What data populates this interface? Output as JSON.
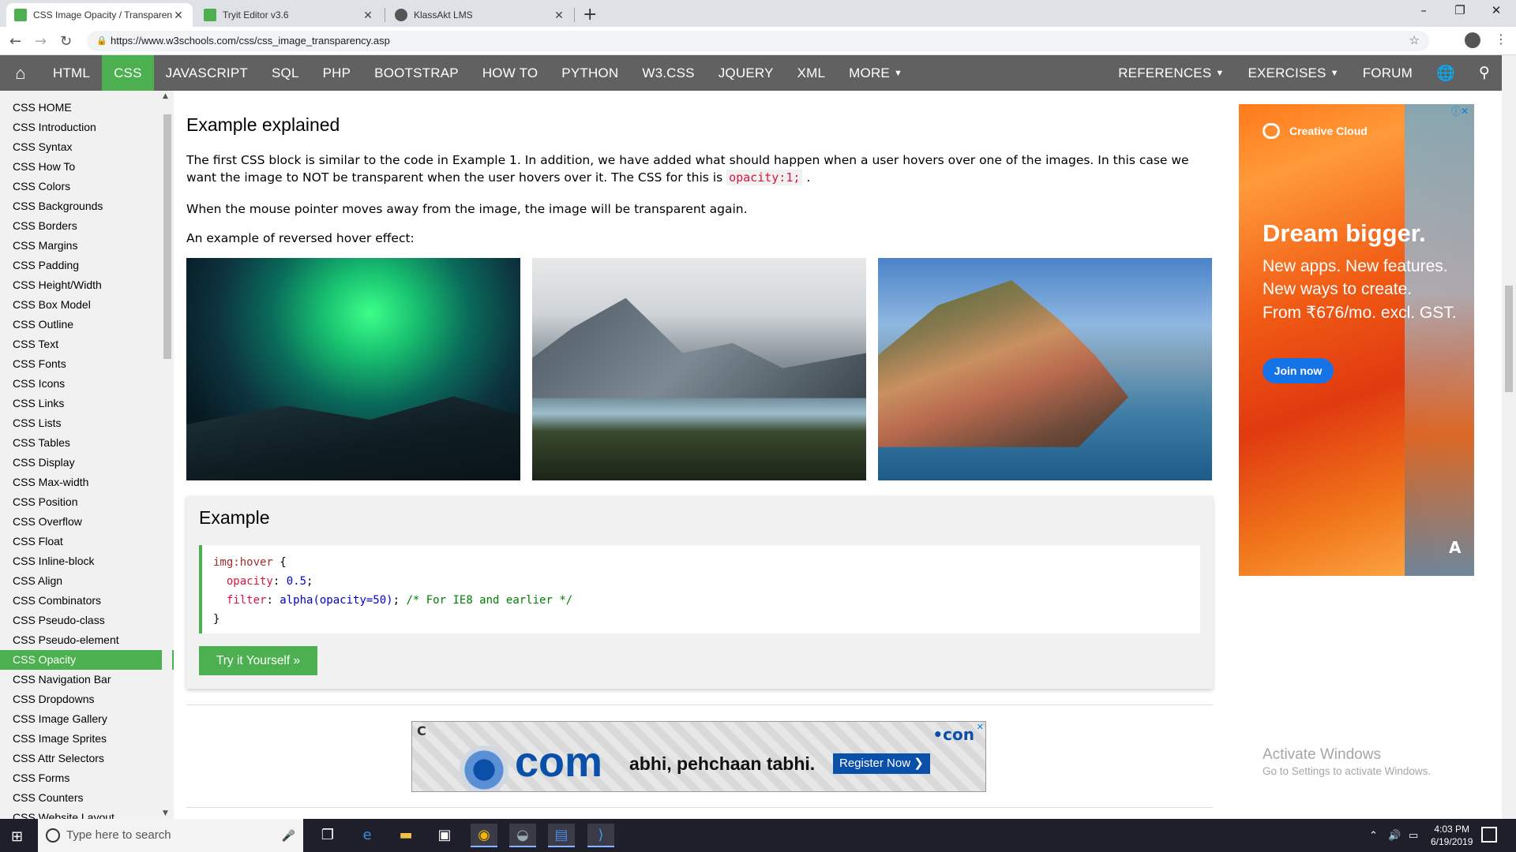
{
  "browser": {
    "tabs": [
      {
        "title": "CSS Image Opacity / Transparenc",
        "favicon_color": "#4CAF50"
      },
      {
        "title": "Tryit Editor v3.6",
        "favicon_color": "#4CAF50"
      },
      {
        "title": "KlassAkt LMS",
        "favicon_color": "#555555"
      }
    ],
    "url": "https://www.w3schools.com/css/css_image_transparency.asp",
    "new_tab": "+",
    "minimize": "–",
    "restore": "❐",
    "close": "✕"
  },
  "topnav": {
    "home_icon": "⌂",
    "items": [
      "HTML",
      "CSS",
      "JAVASCRIPT",
      "SQL",
      "PHP",
      "BOOTSTRAP",
      "HOW TO",
      "PYTHON",
      "W3.CSS",
      "JQUERY",
      "XML"
    ],
    "more": "MORE",
    "right": [
      "REFERENCES",
      "EXERCISES",
      "FORUM"
    ],
    "active": "CSS",
    "accent": "#4CAF50"
  },
  "sidebar": {
    "items": [
      "CSS HOME",
      "CSS Introduction",
      "CSS Syntax",
      "CSS How To",
      "CSS Colors",
      "CSS Backgrounds",
      "CSS Borders",
      "CSS Margins",
      "CSS Padding",
      "CSS Height/Width",
      "CSS Box Model",
      "CSS Outline",
      "CSS Text",
      "CSS Fonts",
      "CSS Icons",
      "CSS Links",
      "CSS Lists",
      "CSS Tables",
      "CSS Display",
      "CSS Max-width",
      "CSS Position",
      "CSS Overflow",
      "CSS Float",
      "CSS Inline-block",
      "CSS Align",
      "CSS Combinators",
      "CSS Pseudo-class",
      "CSS Pseudo-element",
      "CSS Opacity",
      "CSS Navigation Bar",
      "CSS Dropdowns",
      "CSS Image Gallery",
      "CSS Image Sprites",
      "CSS Attr Selectors",
      "CSS Forms",
      "CSS Counters",
      "CSS Website Layout"
    ],
    "active": "CSS Opacity"
  },
  "main": {
    "heading": "Example explained",
    "para1_a": "The first CSS block is similar to the code in Example 1. In addition, we have added what should happen when a user hovers over one of the images. In this case we want the image to NOT be transparent when the user hovers over it. The CSS for this is",
    "para1_code": "opacity:1;",
    "para1_end": ".",
    "para2": "When the mouse pointer moves away from the image, the image will be transparent again.",
    "para3": "An example of reversed hover effect:",
    "images": [
      "northern lights",
      "mountains",
      "cinque terre"
    ],
    "example": {
      "title": "Example",
      "code": {
        "selector": "img:hover",
        "open": " {",
        "prop1": "opacity",
        "val1": " 0.5",
        "prop2": "filter",
        "val2": " alpha(opacity=50)",
        "comment": " /* For IE8 and earlier */",
        "close": "}"
      },
      "button": "Try it Yourself »"
    }
  },
  "bottom_ad": {
    "brand": "com",
    "tagline": "abhi, pehchaan tabhi.",
    "cta": "Register Now",
    "small_logo": "•con",
    "c_logo": "C",
    "close": "✕"
  },
  "right_ad": {
    "brand": "Creative Cloud",
    "headline": "Dream bigger.",
    "lines": [
      "New apps. New features.",
      "New ways to create.",
      "From ₹676/mo. excl. GST."
    ],
    "cta": "Join now",
    "adobe": "A",
    "close": "ⓘ✕"
  },
  "watermark": {
    "title": "Activate Windows",
    "subtitle": "Go to Settings to activate Windows."
  },
  "taskbar": {
    "search_placeholder": "Type here to search",
    "time": "4:03 PM",
    "date": "6/19/2019"
  }
}
